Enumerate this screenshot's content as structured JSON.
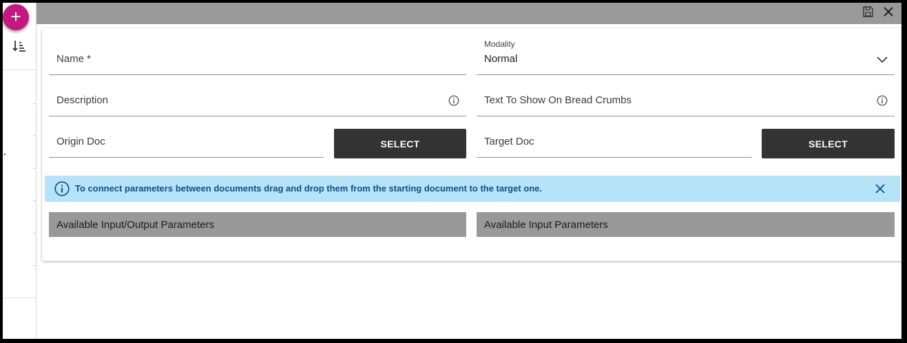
{
  "rail": {
    "add_label": "+"
  },
  "form": {
    "name_label": "Name *",
    "modality_label": "Modality",
    "modality_value": "Normal",
    "description_label": "Description",
    "breadcrumb_text_label": "Text To Show On Bread Crumbs",
    "origin_doc_label": "Origin Doc",
    "target_doc_label": "Target Doc",
    "select_origin_label": "SELECT",
    "select_target_label": "SELECT"
  },
  "alert": {
    "text": "To connect parameters between documents drag and drop them from the starting document to the target one."
  },
  "panels": {
    "left_title": "Available Input/Output Parameters",
    "right_title": "Available Input Parameters"
  },
  "colors": {
    "fab": "#c2187f",
    "topbar": "#9a9a9a",
    "button": "#333333",
    "alert_bg": "#b6e3f8",
    "alert_text": "#0d4f86",
    "panel_header": "#999999"
  },
  "icons": [
    "add-icon",
    "sort-icon",
    "save-icon",
    "close-icon",
    "info-icon",
    "chevron-down-icon"
  ]
}
